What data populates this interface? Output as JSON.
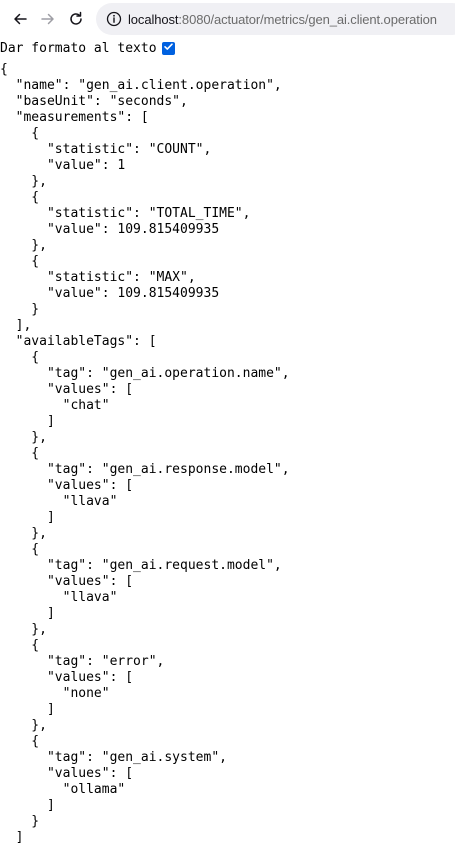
{
  "browser": {
    "url_host": "localhost",
    "url_rest": ":8080/actuator/metrics/gen_ai.client.operation"
  },
  "pretty_print": {
    "label": "Dar formato al texto",
    "checked": true
  },
  "json_lines": [
    "{",
    "  \"name\": \"gen_ai.client.operation\",",
    "  \"baseUnit\": \"seconds\",",
    "  \"measurements\": [",
    "    {",
    "      \"statistic\": \"COUNT\",",
    "      \"value\": 1",
    "    },",
    "    {",
    "      \"statistic\": \"TOTAL_TIME\",",
    "      \"value\": 109.815409935",
    "    },",
    "    {",
    "      \"statistic\": \"MAX\",",
    "      \"value\": 109.815409935",
    "    }",
    "  ],",
    "  \"availableTags\": [",
    "    {",
    "      \"tag\": \"gen_ai.operation.name\",",
    "      \"values\": [",
    "        \"chat\"",
    "      ]",
    "    },",
    "    {",
    "      \"tag\": \"gen_ai.response.model\",",
    "      \"values\": [",
    "        \"llava\"",
    "      ]",
    "    },",
    "    {",
    "      \"tag\": \"gen_ai.request.model\",",
    "      \"values\": [",
    "        \"llava\"",
    "      ]",
    "    },",
    "    {",
    "      \"tag\": \"error\",",
    "      \"values\": [",
    "        \"none\"",
    "      ]",
    "    },",
    "    {",
    "      \"tag\": \"gen_ai.system\",",
    "      \"values\": [",
    "        \"ollama\"",
    "      ]",
    "    }",
    "  ]"
  ]
}
